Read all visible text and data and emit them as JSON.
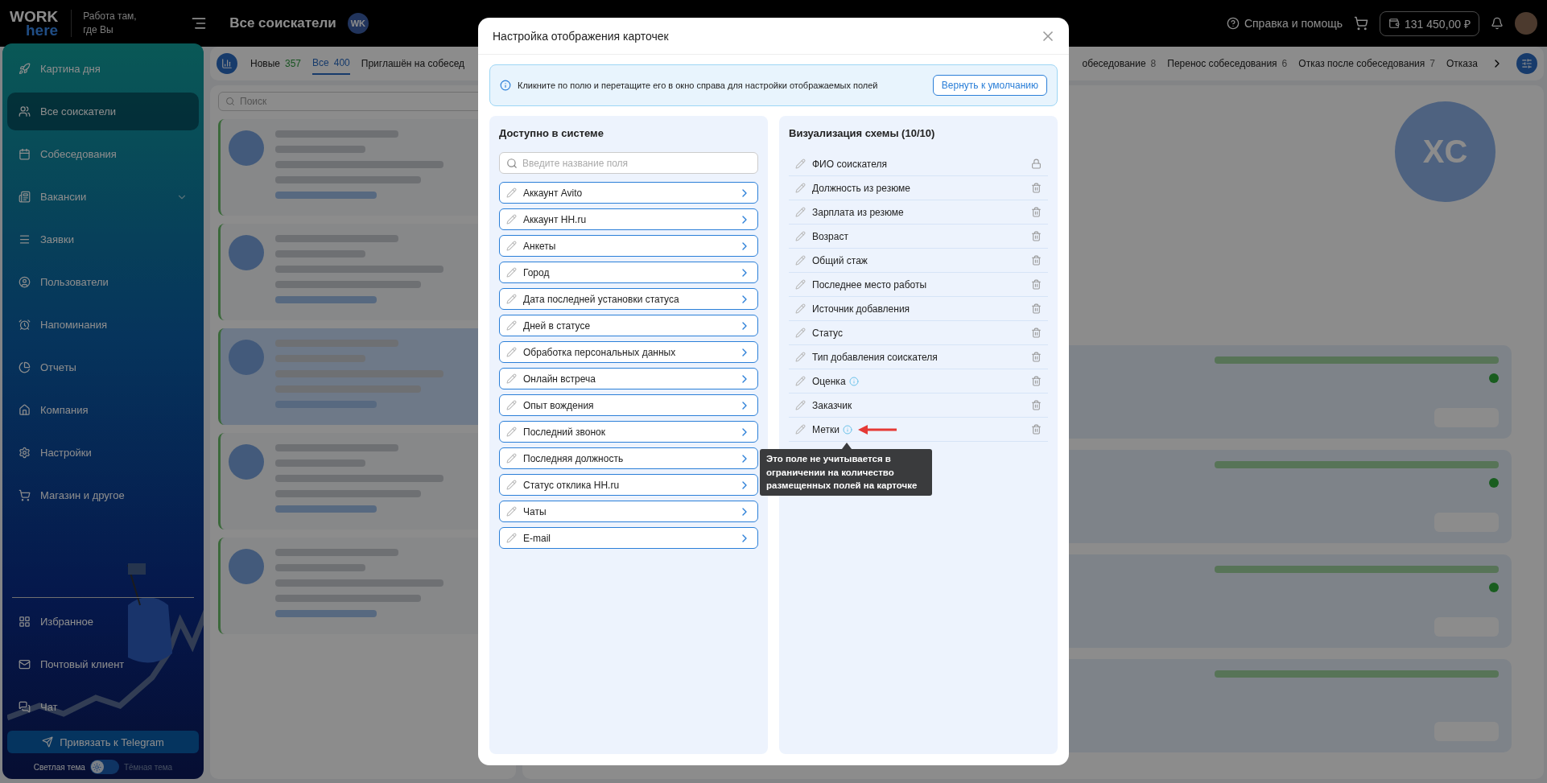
{
  "topbar": {
    "logo_top": "WORK",
    "logo_bottom": "here",
    "slogan": "Работа там, где Вы",
    "page_title": "Все соискатели",
    "account_initials": "WK",
    "help": "Справка и помощь",
    "balance": "131 450,00 ₽"
  },
  "sidebar": {
    "items": [
      {
        "label": "Картина дня",
        "selected": false,
        "submenu": false
      },
      {
        "label": "Все соискатели",
        "selected": true,
        "submenu": false
      },
      {
        "label": "Собеседования",
        "selected": false,
        "submenu": false
      },
      {
        "label": "Вакансии",
        "selected": false,
        "submenu": true
      },
      {
        "label": "Заявки",
        "selected": false,
        "submenu": false
      },
      {
        "label": "Пользователи",
        "selected": false,
        "submenu": false
      },
      {
        "label": "Напоминания",
        "selected": false,
        "submenu": false
      },
      {
        "label": "Отчеты",
        "selected": false,
        "submenu": false
      },
      {
        "label": "Компания",
        "selected": false,
        "submenu": false
      },
      {
        "label": "Настройки",
        "selected": false,
        "submenu": false
      },
      {
        "label": "Магазин и другое",
        "selected": false,
        "submenu": false
      }
    ],
    "bottom_items": [
      {
        "label": "Избранное"
      },
      {
        "label": "Почтовый клиент"
      },
      {
        "label": "Чат"
      }
    ],
    "telegram_button": "Привязать к Telegram",
    "theme": {
      "light_label": "Светлая тема",
      "dark_label": "Тёмная тема",
      "dark": false
    }
  },
  "tabs": [
    {
      "label": "Новые",
      "count": "357",
      "selected": false
    },
    {
      "label": "Все",
      "count": "400",
      "selected": true
    },
    {
      "label": "Приглашён на собесед",
      "selected": false
    }
  ],
  "tabs_right": [
    {
      "label": "обеседование",
      "count": "8",
      "selected": false
    },
    {
      "label": "Перенос собеседования",
      "count": "6",
      "selected": false
    },
    {
      "label": "Отказ после собеседования",
      "count": "7",
      "selected": false
    },
    {
      "label": "Отказа",
      "selected": false
    }
  ],
  "candidates": {
    "search": {
      "placeholder": "Поиск"
    },
    "cards": [
      {
        "highlighted": false
      },
      {
        "highlighted": false
      },
      {
        "highlighted": true
      },
      {
        "highlighted": false
      },
      {
        "highlighted": false
      }
    ]
  },
  "profile": {
    "initials": "XC",
    "events": [
      {
        "has_status": true
      },
      {
        "has_status": true
      },
      {
        "has_status": true
      },
      {
        "has_status": false
      }
    ]
  },
  "modal": {
    "title": "Настройка отображения карточек",
    "info": "Кликните по полю и перетащите его в окно справа для настройки отображаемых полей",
    "reset_button": "Вернуть к умолчанию",
    "available": {
      "title": "Доступно в системе",
      "search": {
        "placeholder": "Введите название поля"
      },
      "fields": [
        "Аккаунт Avito",
        "Аккаунт HH.ru",
        "Анкеты",
        "Город",
        "Дата последней установки статуса",
        "Дней в статусе",
        "Обработка персональных данных",
        "Онлайн встреча",
        "Опыт вождения",
        "Последний звонок",
        "Последняя должность",
        "Статус отклика HH.ru",
        "Чаты",
        "E-mail"
      ]
    },
    "schema": {
      "title": "Визуализация схемы (10/10)",
      "fields": [
        {
          "label": "ФИО соискателя",
          "locked": true,
          "info": false
        },
        {
          "label": "Должность из резюме",
          "locked": false,
          "info": false
        },
        {
          "label": "Зарплата из резюме",
          "locked": false,
          "info": false
        },
        {
          "label": "Возраст",
          "locked": false,
          "info": false
        },
        {
          "label": "Общий стаж",
          "locked": false,
          "info": false
        },
        {
          "label": "Последнее место работы",
          "locked": false,
          "info": false
        },
        {
          "label": "Источник добавления",
          "locked": false,
          "info": false
        },
        {
          "label": "Статус",
          "locked": false,
          "info": false
        },
        {
          "label": "Тип добавления соискателя",
          "locked": false,
          "info": false
        },
        {
          "label": "Оценка",
          "locked": false,
          "info": true
        },
        {
          "label": "Заказчик",
          "locked": false,
          "info": false
        },
        {
          "label": "Метки",
          "locked": false,
          "info": true,
          "tooltip": "Это поле не учитывается в ограничении на количество размещенных полей на карточке"
        }
      ]
    }
  }
}
